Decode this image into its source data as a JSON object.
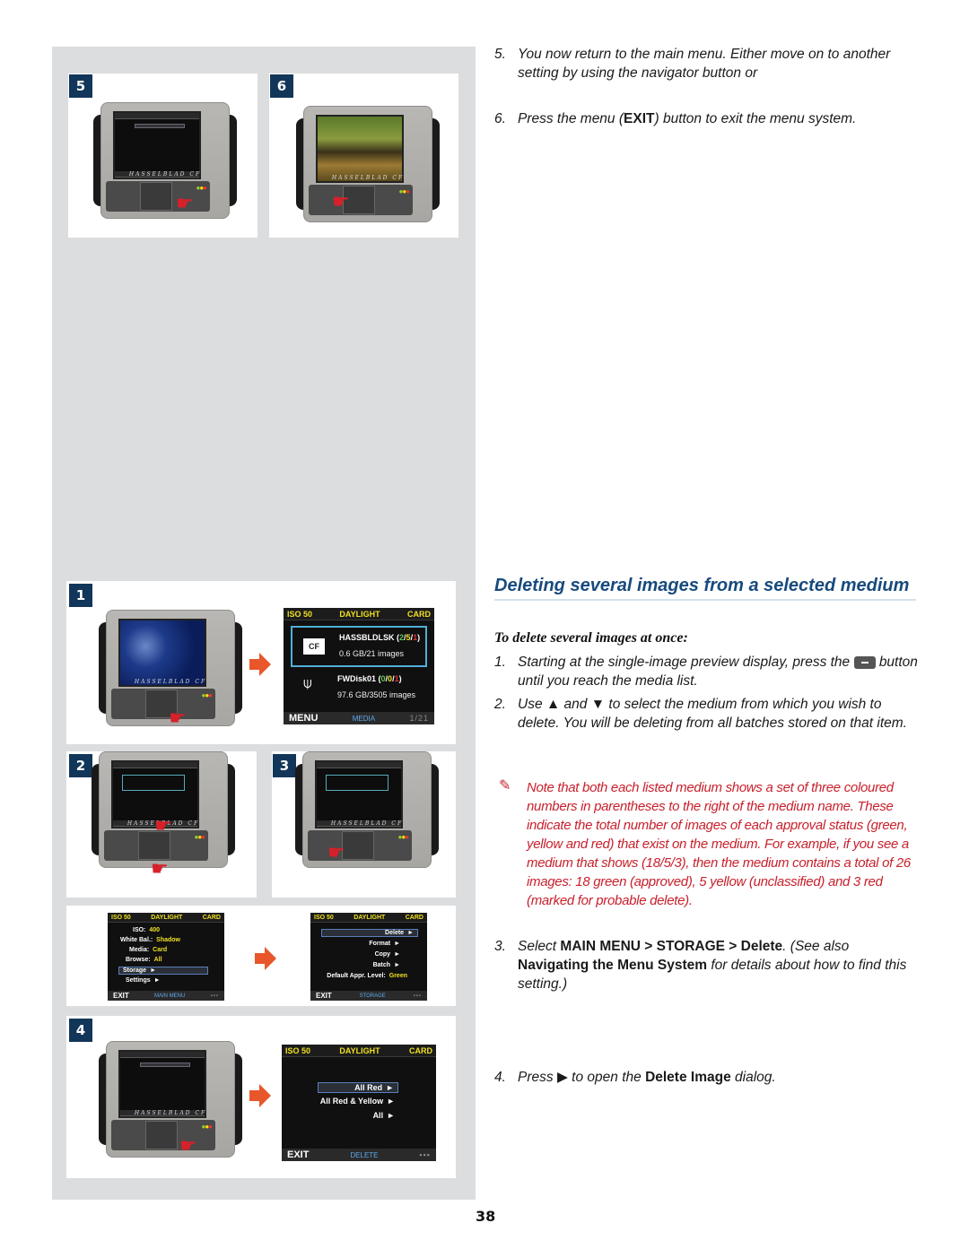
{
  "right_column": {
    "steps_top": [
      {
        "num": "5.",
        "text": "You now return to the main menu. Either move on to another setting by using the navigator button or"
      },
      {
        "num": "6.",
        "pre": "Press the menu (",
        "bold": "EXIT",
        "post": ") button to exit the menu system."
      }
    ],
    "section_heading": "Deleting several images from a selected medium",
    "subheading": "To delete several images at once:",
    "steps": [
      {
        "num": "1.",
        "pre": "Starting at the single-image preview display, press the",
        "icon": "minus-button-icon",
        "post": "button until you reach the media list."
      },
      {
        "num": "2.",
        "pre": "Use",
        "up": "▲",
        "mid": "and",
        "down": "▼",
        "post": "to select the medium from which you wish to delete. You will be deleting from all batches stored on that item."
      },
      {
        "num": "3.",
        "pre": "Select",
        "bold1": "MAIN MENU > STORAGE > Delete",
        "mid": ". (See also",
        "bold2": "Navigating the Menu System",
        "post": "for details about how to find this setting.)"
      },
      {
        "num": "4.",
        "pre": "Press",
        "play": "▶",
        "mid": "to open the",
        "bold": "Delete Image",
        "post": "dialog."
      }
    ],
    "note": "Note that both each listed medium shows a set of three coloured numbers in parentheses to the right of the medium name. These indicate the total number of images of each approval status (green, yellow and red) that exist on the medium. For example, if you see a medium that shows (18/5/3), then the medium contains a total of 26 images: 18 green (approved), 5 yellow (unclassified) and 3 red (marked for probable delete)."
  },
  "figures": {
    "badges": [
      "5",
      "6",
      "1",
      "2",
      "3",
      "4"
    ],
    "device_brand": "HASSELBLAD CF",
    "status_bar": {
      "iso": "ISO 50",
      "wb": "DAYLIGHT",
      "media": "CARD"
    },
    "media_list": {
      "items": [
        {
          "name": "HASSBLDLSK",
          "counts": [
            "2",
            "5",
            "1"
          ],
          "info": "0.6 GB/21 images",
          "type": "CF"
        },
        {
          "name": "FWDisk01",
          "counts": [
            "0",
            "0",
            "1"
          ],
          "info": "97.6 GB/3505 images",
          "type": "FireWire"
        }
      ],
      "bottom_left": "MENU",
      "bottom_mode": "MEDIA",
      "bottom_right": "1/21"
    },
    "main_menu": {
      "rows": [
        {
          "label": "ISO:",
          "value": "400"
        },
        {
          "label": "White Bal.:",
          "value": "Shadow"
        },
        {
          "label": "Media:",
          "value": "Card"
        },
        {
          "label": "Browse:",
          "value": "All"
        },
        {
          "label": "Storage",
          "value": "►",
          "selected": true
        },
        {
          "label": "Settings",
          "value": "►"
        }
      ],
      "exit": "EXIT",
      "mode": "MAIN MENU"
    },
    "storage_menu": {
      "rows": [
        {
          "label": "Delete",
          "value": "►",
          "selected": true
        },
        {
          "label": "Format",
          "value": "►"
        },
        {
          "label": "Copy",
          "value": "►"
        },
        {
          "label": "Batch",
          "value": "►"
        },
        {
          "label": "Default Appr. Level:",
          "value": "Green"
        }
      ],
      "exit": "EXIT",
      "mode": "STORAGE"
    },
    "delete_menu": {
      "rows": [
        {
          "label": "All Red",
          "value": "►",
          "selected": true
        },
        {
          "label": "All Red & Yellow",
          "value": "►"
        },
        {
          "label": "All",
          "value": "►"
        }
      ],
      "exit": "EXIT",
      "mode": "DELETE"
    }
  },
  "page_number": "38",
  "colors": {
    "heading": "#174a7c",
    "note": "#c8202c",
    "badge": "#12365a",
    "arrow": "#e8562a"
  }
}
